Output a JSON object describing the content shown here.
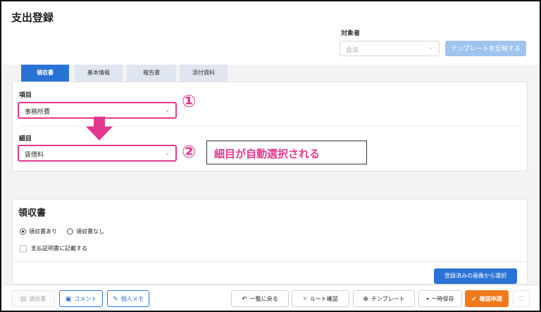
{
  "page": {
    "title": "支出登録"
  },
  "target": {
    "label": "対象者",
    "placeholder": "会派",
    "apply_template_label": "テンプレートを反映する"
  },
  "tabs": [
    {
      "label": "領収書",
      "active": true
    },
    {
      "label": "基本情報",
      "active": false
    },
    {
      "label": "報告書",
      "active": false
    },
    {
      "label": "添付資料",
      "active": false
    }
  ],
  "item": {
    "label": "項目",
    "value": "事務所費",
    "marker": "①"
  },
  "subitem": {
    "label": "細目",
    "value": "賃借料",
    "marker": "②"
  },
  "callout": {
    "text": "細目が自動選択される"
  },
  "receipt": {
    "title": "領収書",
    "option_yes": "領収書あり",
    "option_no": "領収書なし",
    "option_selected": "領収書あり",
    "payment_cert_label": "支払証明書に記載する",
    "select_image_button": "登録済みの画像から選択"
  },
  "footer": {
    "receipt": "領収書",
    "comment": "コメント",
    "personal_memo": "個人メモ",
    "back_to_list": "一覧に戻る",
    "route_check": "ルート確認",
    "template": "テンプレート",
    "temp_save": "一時保存",
    "confirm_apply": "確認申請"
  },
  "icons": {
    "select": "chevron-down-icon",
    "arrow": "arrow-down-icon"
  },
  "colors": {
    "accent": "#2a73d6",
    "highlight": "#e2398e",
    "orange": "#f07a1b"
  }
}
